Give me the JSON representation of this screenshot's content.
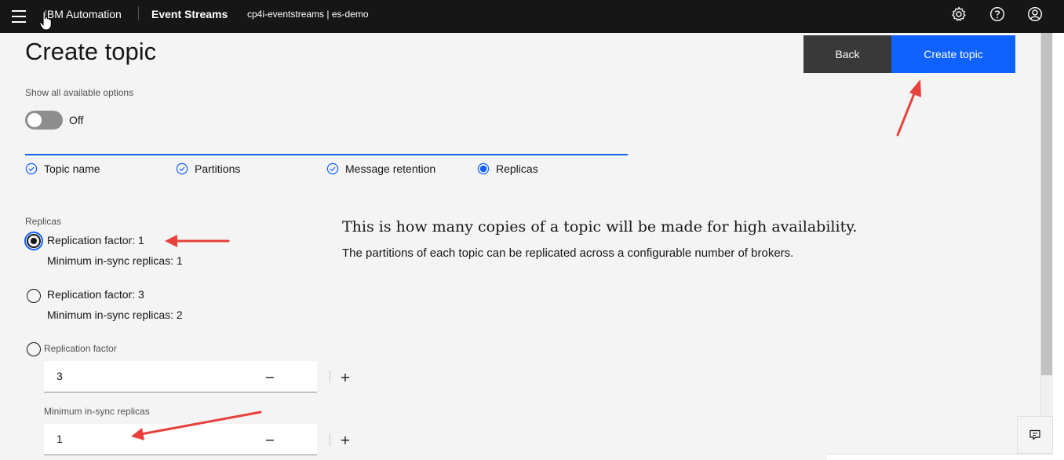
{
  "header": {
    "brand": "IBM Automation",
    "product": "Event Streams",
    "instance": "cp4i-eventstreams | es-demo",
    "icons": [
      "menu-icon",
      "settings-icon",
      "help-icon",
      "user-icon"
    ]
  },
  "page": {
    "title": "Create topic",
    "back_label": "Back",
    "create_label": "Create topic"
  },
  "toggle": {
    "label": "Show all available options",
    "state": "Off"
  },
  "steps": [
    {
      "label": "Topic name",
      "status": "complete"
    },
    {
      "label": "Partitions",
      "status": "complete"
    },
    {
      "label": "Message retention",
      "status": "complete"
    },
    {
      "label": "Replicas",
      "status": "current"
    }
  ],
  "replicas": {
    "section_label": "Replicas",
    "option1": {
      "title": "Replication factor: 1",
      "sub": "Minimum in-sync replicas: 1",
      "selected": true
    },
    "option2": {
      "title": "Replication factor: 3",
      "sub": "Minimum in-sync replicas: 2",
      "selected": false
    },
    "option3": {
      "title": "Replication factor",
      "selected": false
    },
    "replication_factor_value": "3",
    "min_insync_label": "Minimum in-sync replicas",
    "min_insync_value": "1"
  },
  "description": {
    "heading": "This is how many copies of a topic will be made for high availability.",
    "body": "The partitions of each topic can be replicated across a configurable number of brokers."
  },
  "colors": {
    "accent": "#0f62fe",
    "header_bg": "#161616",
    "back_button": "#393939",
    "annotation_arrow": "#e8413c"
  }
}
